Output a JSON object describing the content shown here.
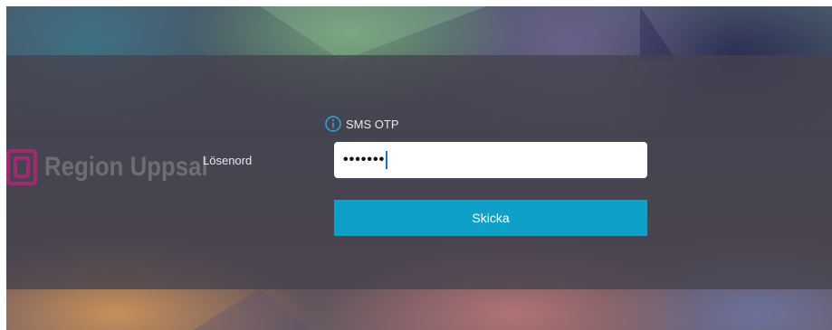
{
  "branding": {
    "logo_text": "Region Uppsal",
    "logo_color": "#c0207a"
  },
  "form": {
    "password_label": "Lösenord",
    "auth_method_label": "SMS OTP",
    "password_masked": "•••••••",
    "submit_label": "Skicka"
  },
  "colors": {
    "accent": "#0fa0c8",
    "info_icon": "#2aa8e0"
  },
  "icons": {
    "info": "info-circle-icon",
    "logo": "region-logo-icon"
  }
}
